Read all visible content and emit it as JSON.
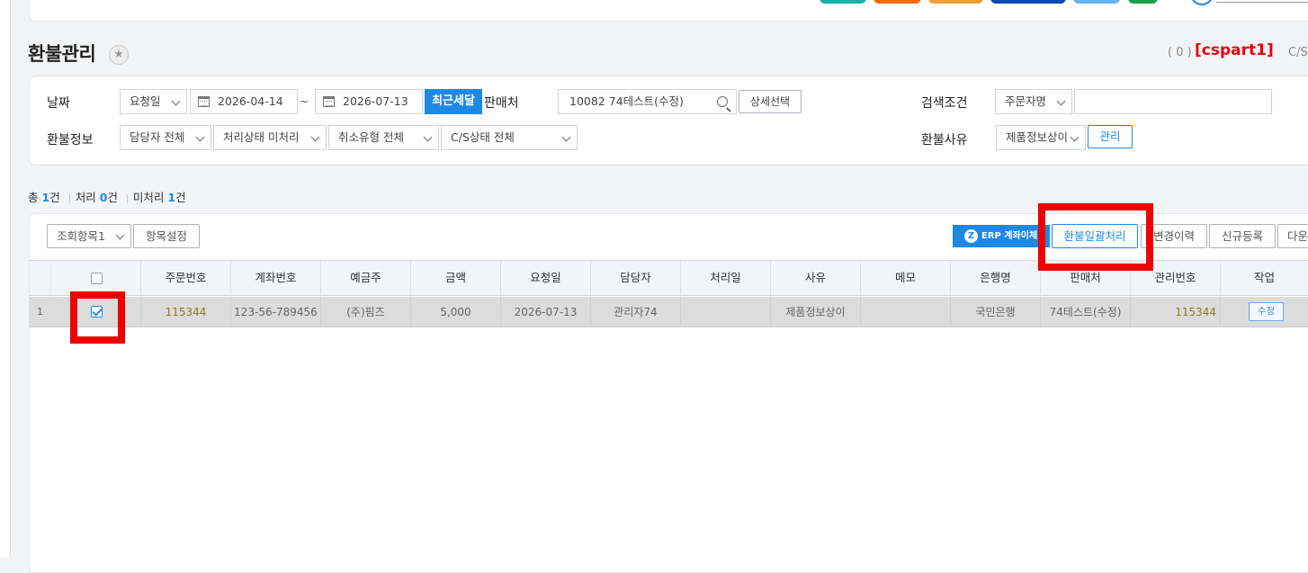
{
  "colors": {
    "accent": "#1e88e5",
    "highlight": "#ee0000",
    "user_id": "#e60012",
    "top_buttons": [
      "#13b5a6",
      "#f26b0f",
      "#f0a030",
      "#0a47b8",
      "#63b4f0",
      "#1aa04a"
    ]
  },
  "header": {
    "title": "환불관리",
    "count": "( 0 )",
    "user_id": "[cspart1]",
    "cs_label": "C/S"
  },
  "search": {
    "date_label": "날짜",
    "date_type": "요청일",
    "date_from": "2026-04-14",
    "date_tilde": "~",
    "date_to": "2026-07-13",
    "recent_3m": "최근세달",
    "seller_label": "판매처",
    "seller_value": "10082 74테스트(수정)",
    "detail_select": "상세선택",
    "condition_label": "검색조건",
    "condition_type": "주문자명",
    "condition_value": "",
    "refund_info_label": "환불정보",
    "manager": "담당자 전체",
    "process_status": "처리상태 미처리",
    "cancel_type": "취소유형 전체",
    "cs_status": "C/S상태 전체",
    "reason_label": "환불사유",
    "reason_value": "제품정보상이",
    "manage_button": "관리"
  },
  "summary": {
    "total_label": "총",
    "total": "1",
    "processed_label": "처리",
    "processed": "0",
    "unprocessed_label": "미처리",
    "unprocessed": "1",
    "unit": "건"
  },
  "toolbar": {
    "view_items": "조회항목1",
    "item_settings": "항목설정",
    "erp_transfer": "ERP 계좌이체",
    "batch_refund": "환불일괄처리",
    "change_history": "변경이력",
    "new_register": "신규등록",
    "download": "다운"
  },
  "table": {
    "columns": [
      "주문번호",
      "계좌번호",
      "예금주",
      "금액",
      "요청일",
      "담당자",
      "처리일",
      "사유",
      "메모",
      "은행명",
      "판매처",
      "관리번호",
      "작업"
    ],
    "rows": [
      {
        "no": "1",
        "checked": true,
        "cells": [
          "115344",
          "123-56-789456",
          "(주)핌즈",
          "5,000",
          "2026-07-13",
          "관리자74",
          "",
          "제품정보상이",
          "",
          "국민은행",
          "74테스트(수정)",
          "115344"
        ],
        "action": "수정"
      }
    ]
  }
}
